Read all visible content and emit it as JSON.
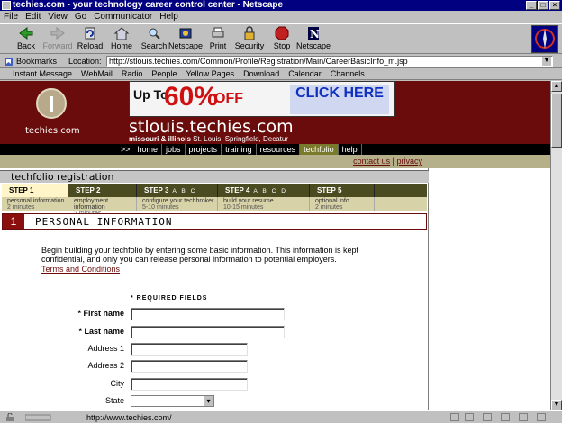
{
  "window": {
    "title": "techies.com - your technology career control center - Netscape"
  },
  "menu": [
    "File",
    "Edit",
    "View",
    "Go",
    "Communicator",
    "Help"
  ],
  "toolbar": [
    {
      "label": "Back",
      "icon": "back-icon",
      "disabled": false
    },
    {
      "label": "Forward",
      "icon": "forward-icon",
      "disabled": true
    },
    {
      "label": "Reload",
      "icon": "reload-icon",
      "disabled": false
    },
    {
      "label": "Home",
      "icon": "home-icon",
      "disabled": false
    },
    {
      "label": "Search",
      "icon": "search-icon",
      "disabled": false
    },
    {
      "label": "Netscape",
      "icon": "netscape-icon",
      "disabled": false
    },
    {
      "label": "Print",
      "icon": "print-icon",
      "disabled": false
    },
    {
      "label": "Security",
      "icon": "security-icon",
      "disabled": false
    },
    {
      "label": "Stop",
      "icon": "stop-icon",
      "disabled": false
    },
    {
      "label": "Netscape",
      "icon": "netscape-n-icon",
      "disabled": false
    }
  ],
  "location": {
    "bookmarks_label": "Bookmarks",
    "location_label": "Location:",
    "url": "http://stlouis.techies.com/Common/Profile/Registration/Main/CareerBasicInfo_m.jsp"
  },
  "personal_toolbar": [
    "Instant Message",
    "WebMail",
    "Radio",
    "People",
    "Yellow Pages",
    "Download",
    "Calendar",
    "Channels"
  ],
  "header": {
    "logo_text": "techies.com",
    "ad": {
      "upto": "Up To",
      "percent": "60%",
      "off": "OFF",
      "click": "CLICK HERE"
    },
    "site_name": "stlouis.techies.com",
    "site_sub": "missouri & illinois",
    "site_cities": "St. Louis, Springfield, Decatur"
  },
  "nav": {
    "arrow": ">>",
    "items": [
      "home",
      "jobs",
      "projects",
      "training",
      "resources",
      "techfolio",
      "help"
    ],
    "active": "techfolio"
  },
  "links": {
    "contact": "contact us",
    "sep": "|",
    "privacy": "privacy"
  },
  "registration": {
    "title": "techfolio registration",
    "steps": [
      {
        "label": "STEP 1",
        "sub": "",
        "desc": "personal information",
        "time": "2 minutes",
        "active": true
      },
      {
        "label": "STEP 2",
        "sub": "",
        "desc": "employment information",
        "time": "2 minutes",
        "active": false
      },
      {
        "label": "STEP 3",
        "sub": "A B C",
        "desc": "configure your techbroker",
        "time": "5-10 minutes",
        "active": false
      },
      {
        "label": "STEP 4",
        "sub": "A B C D",
        "desc": "build your resume",
        "time": "10-15 minutes",
        "active": false
      },
      {
        "label": "STEP 5",
        "sub": "",
        "desc": "optional info",
        "time": "2 minutes",
        "active": false
      }
    ]
  },
  "section": {
    "number": "1",
    "title": "PERSONAL INFORMATION",
    "intro": "Begin building your techfolio by entering some basic information. This information is kept confidential, and only you can release personal information to potential employers.",
    "terms": "Terms and Conditions",
    "required_note": "* REQUIRED FIELDS"
  },
  "form": {
    "first_name": "* First name",
    "last_name": "* Last name",
    "address1": "Address 1",
    "address2": "Address 2",
    "city": "City",
    "state": "State"
  },
  "status": {
    "text": "http://www.techies.com/"
  }
}
